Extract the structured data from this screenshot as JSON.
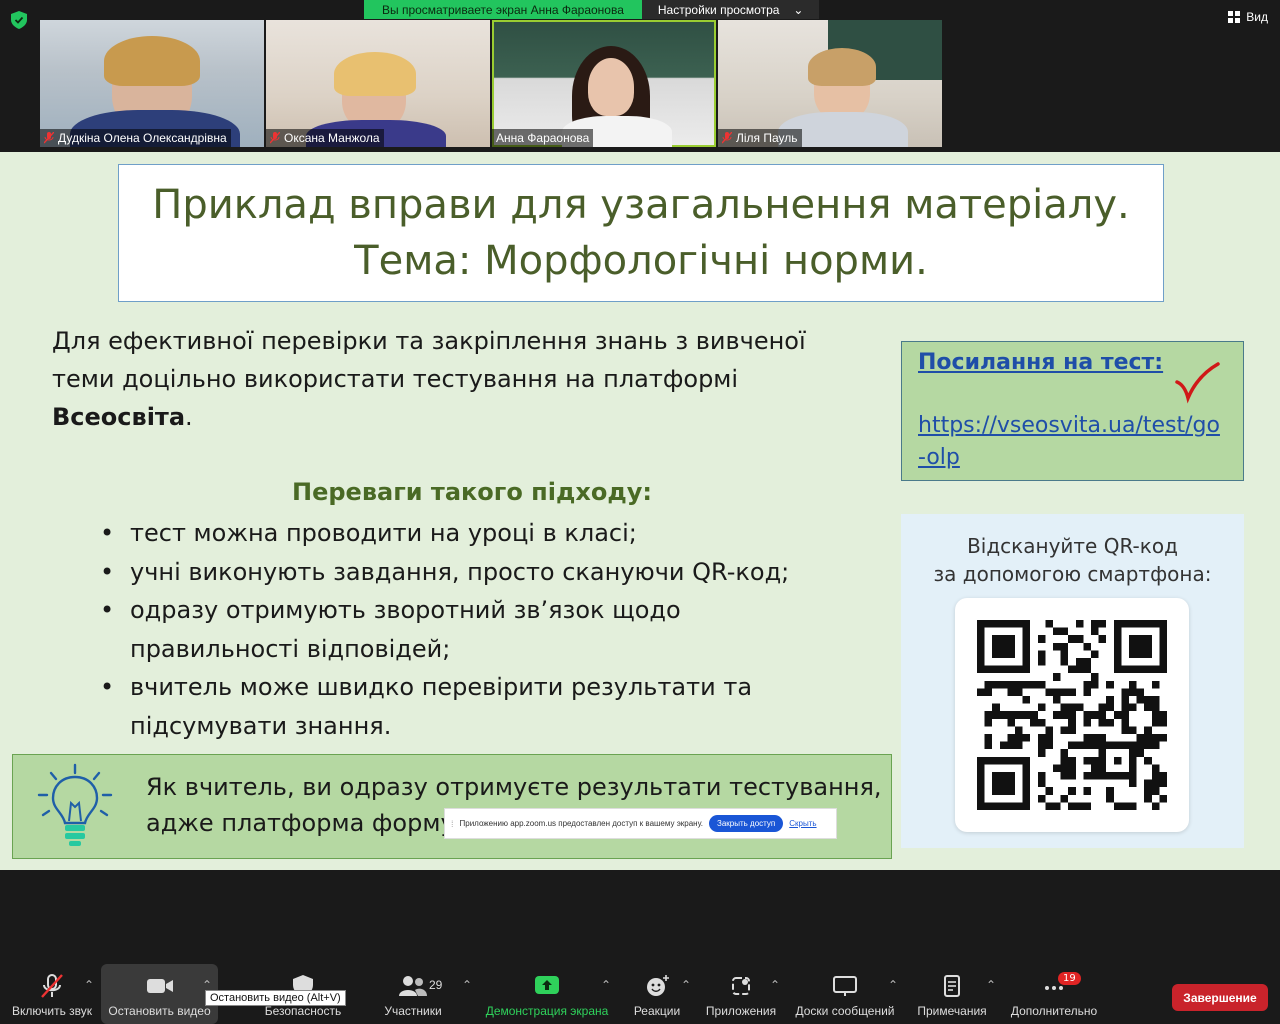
{
  "banner": {
    "viewing": "Вы просматриваете экран Анна Фараонова",
    "settings": "Настройки просмотра"
  },
  "view_button": "Вид",
  "participants": [
    {
      "name": "Дудкіна Олена Олександрівна",
      "muted": true
    },
    {
      "name": "Оксана Манжола",
      "muted": true
    },
    {
      "name": "Анна Фараонова",
      "muted": false
    },
    {
      "name": "Ліля Пауль",
      "muted": true
    }
  ],
  "slide": {
    "title_line1": "Приклад вправи для узагальнення матеріалу.",
    "title_line2": "Тема: Морфологічні норми.",
    "intro_text": "Для ефективної перевірки та закріплення знань з вивченої теми доцільно використати тестування на платформі ",
    "intro_bold": "Всеосвіта",
    "intro_end": ".",
    "advantages_title": "Переваги такого підходу:",
    "bullets": [
      "тест можна проводити на уроці в класі;",
      "учні виконують завдання, просто скануючи QR-код;",
      "одразу отримують зворотний зв’язок щодо правильності відповідей;",
      "вчитель може швидко перевірити результати та підсумувати знання."
    ],
    "callout": "Як вчитель, ви одразу отримуєте результати тестування, адже платформа форму",
    "link_title": "Посилання на тест:",
    "link_url": "https://vseosvita.ua/test/go-olp",
    "qr_caption_line1": "Відскануйте QR-код",
    "qr_caption_line2": "за допомогою смартфона:"
  },
  "toast": {
    "message": "Приложению app.zoom.us предоставлен доступ к вашему экрану.",
    "close_access": "Закрыть доступ",
    "hide": "Скрыть"
  },
  "toolbar": {
    "unmute": "Включить звук",
    "stop_video": "Остановить видео",
    "security": "Безопасность",
    "participants": "Участники",
    "participants_count": "29",
    "share_screen": "Демонстрация экрана",
    "reactions": "Реакции",
    "apps": "Приложения",
    "whiteboards": "Доски сообщений",
    "notes": "Примечания",
    "more": "Дополнительно",
    "more_badge": "19",
    "end": "Завершение"
  },
  "tooltip": "Остановить видео (Alt+V)",
  "colors": {
    "slide_bg": "#e3efdb",
    "title_text": "#4a5e2a",
    "callout_bg": "#b5d8a2",
    "share_green": "#2fd15b",
    "end_red": "#c9232b"
  }
}
